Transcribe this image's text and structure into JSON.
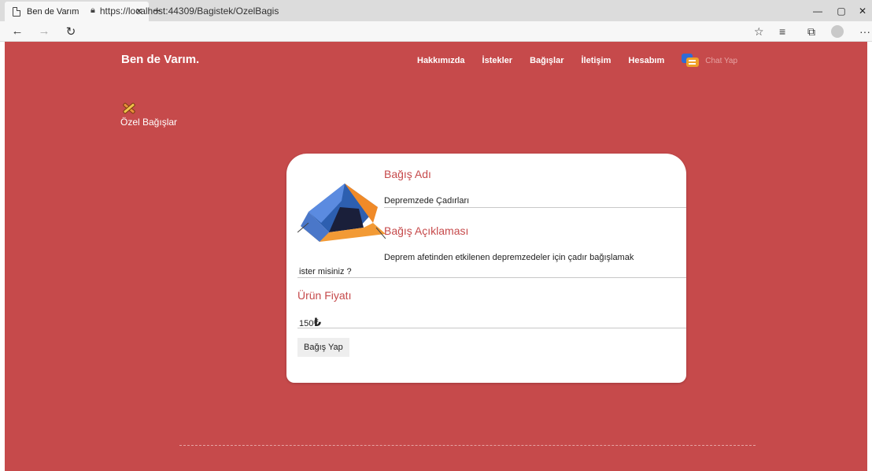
{
  "browser": {
    "tab_title": "Ben de Varım",
    "url": "https://localhost:44309/Bagistek/OzelBagis"
  },
  "navbar": {
    "brand": "Ben de Varım.",
    "links": [
      "Hakkımızda",
      "İstekler",
      "Bağışlar",
      "İletişim",
      "Hesabım"
    ],
    "chat_label": "Chat Yap"
  },
  "section": {
    "title": "Özel Bağışlar"
  },
  "donation": {
    "name_title": "Bağış Adı",
    "name_value": "Depremzede Çadırları",
    "desc_title": "Bağış Açıklaması",
    "desc_line1": "Deprem afetinden etkilenen depremzedeler için çadır bağışlamak",
    "desc_line2": "ister misiniz ?",
    "price_title": "Ürün Fiyatı",
    "price_value": "150",
    "currency": "₺",
    "button_label": "Bağış Yap"
  },
  "colors": {
    "brand_red": "#c64a4b"
  }
}
